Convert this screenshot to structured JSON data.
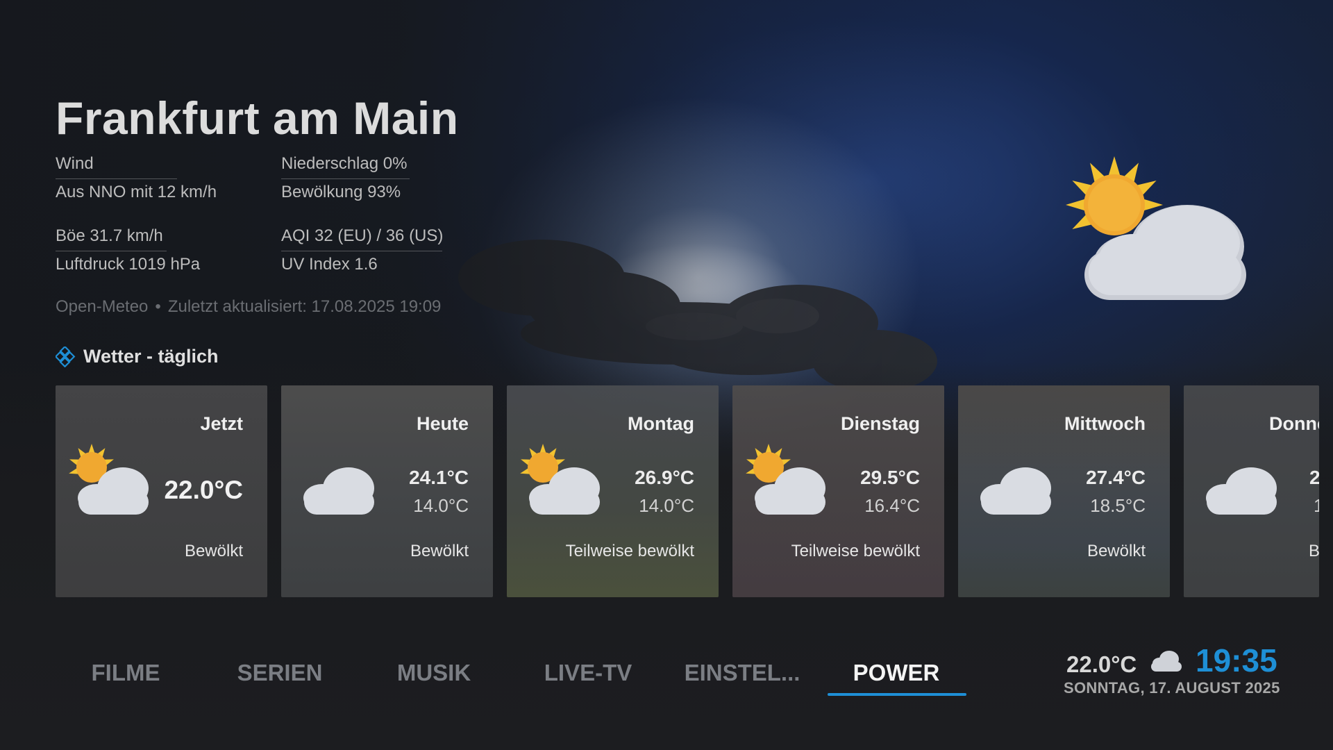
{
  "location": {
    "name": "Frankfurt am Main"
  },
  "details": {
    "wind_label": "Wind",
    "wind_value": "Aus NNO mit 12 km/h",
    "gust": "Böe 31.7 km/h",
    "pressure": "Luftdruck 1019 hPa",
    "precipitation": "Niederschlag 0%",
    "cloud_cover": "Bewölkung 93%",
    "aqi": "AQI 32 (EU) / 36 (US)",
    "uv": "UV Index 1.6"
  },
  "source": {
    "provider": "Open-Meteo",
    "separator": "•",
    "updated": "Zuletzt aktualisiert: 17.08.2025 19:09"
  },
  "section": {
    "title": "Wetter - täglich",
    "icon": "weather-widget-icon"
  },
  "forecast": [
    {
      "day": "Jetzt",
      "temp": "22.0°C",
      "condition": "Bewölkt",
      "icon": "partly-cloudy-icon"
    },
    {
      "day": "Heute",
      "high": "24.1°C",
      "low": "14.0°C",
      "condition": "Bewölkt",
      "icon": "cloud-icon"
    },
    {
      "day": "Montag",
      "high": "26.9°C",
      "low": "14.0°C",
      "condition": "Teilweise bewölkt",
      "icon": "partly-cloudy-icon"
    },
    {
      "day": "Dienstag",
      "high": "29.5°C",
      "low": "16.4°C",
      "condition": "Teilweise bewölkt",
      "icon": "partly-cloudy-icon"
    },
    {
      "day": "Mittwoch",
      "high": "27.4°C",
      "low": "18.5°C",
      "condition": "Bewölkt",
      "icon": "cloud-icon"
    },
    {
      "day": "Donne",
      "high": "2",
      "low": "1",
      "condition": "B",
      "icon": "cloud-icon"
    }
  ],
  "nav": [
    {
      "label": "FILME"
    },
    {
      "label": "SERIEN"
    },
    {
      "label": "MUSIK"
    },
    {
      "label": "LIVE-TV"
    },
    {
      "label": "EINSTEL..."
    },
    {
      "label": "POWER",
      "active": true
    }
  ],
  "status": {
    "temp": "22.0°C",
    "time": "19:35",
    "date": "SONNTAG, 17. AUGUST 2025",
    "icon": "cloud-icon"
  },
  "colors": {
    "accent": "#1e8fd6",
    "card_bg": "#464648",
    "text_dim": "#6a6d72"
  }
}
